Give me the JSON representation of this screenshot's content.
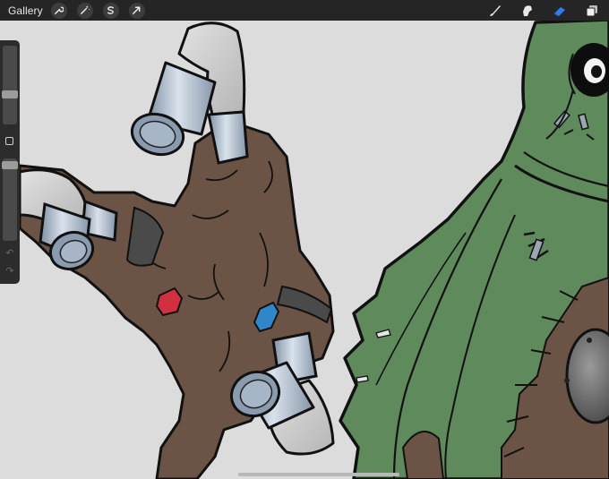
{
  "topbar": {
    "gallery_label": "Gallery",
    "left_tools": [
      "wrench-icon",
      "magic-wand-icon",
      "selection-s-icon",
      "transform-arrow-icon"
    ],
    "right_tools": [
      "brush-icon",
      "smudge-icon",
      "eraser-icon",
      "layers-icon"
    ],
    "active_tool": "eraser-icon",
    "accent_color": "#2f7bf6"
  },
  "sidebar": {
    "brush_size_level": 0.25,
    "opacity_level": 0.05,
    "controls": [
      "brush-size-slider",
      "modify-button",
      "opacity-slider",
      "undo-icon",
      "redo-icon"
    ]
  },
  "canvas": {
    "background_color": "#dcdcdc",
    "colors": {
      "fur_brown": "#6b5445",
      "cloak_green": "#5f8a5c",
      "metal_blue": "#a9b8c8",
      "bone_white": "#d6d6d6",
      "gem_red": "#d23040",
      "gem_blue": "#2f86c9"
    }
  }
}
